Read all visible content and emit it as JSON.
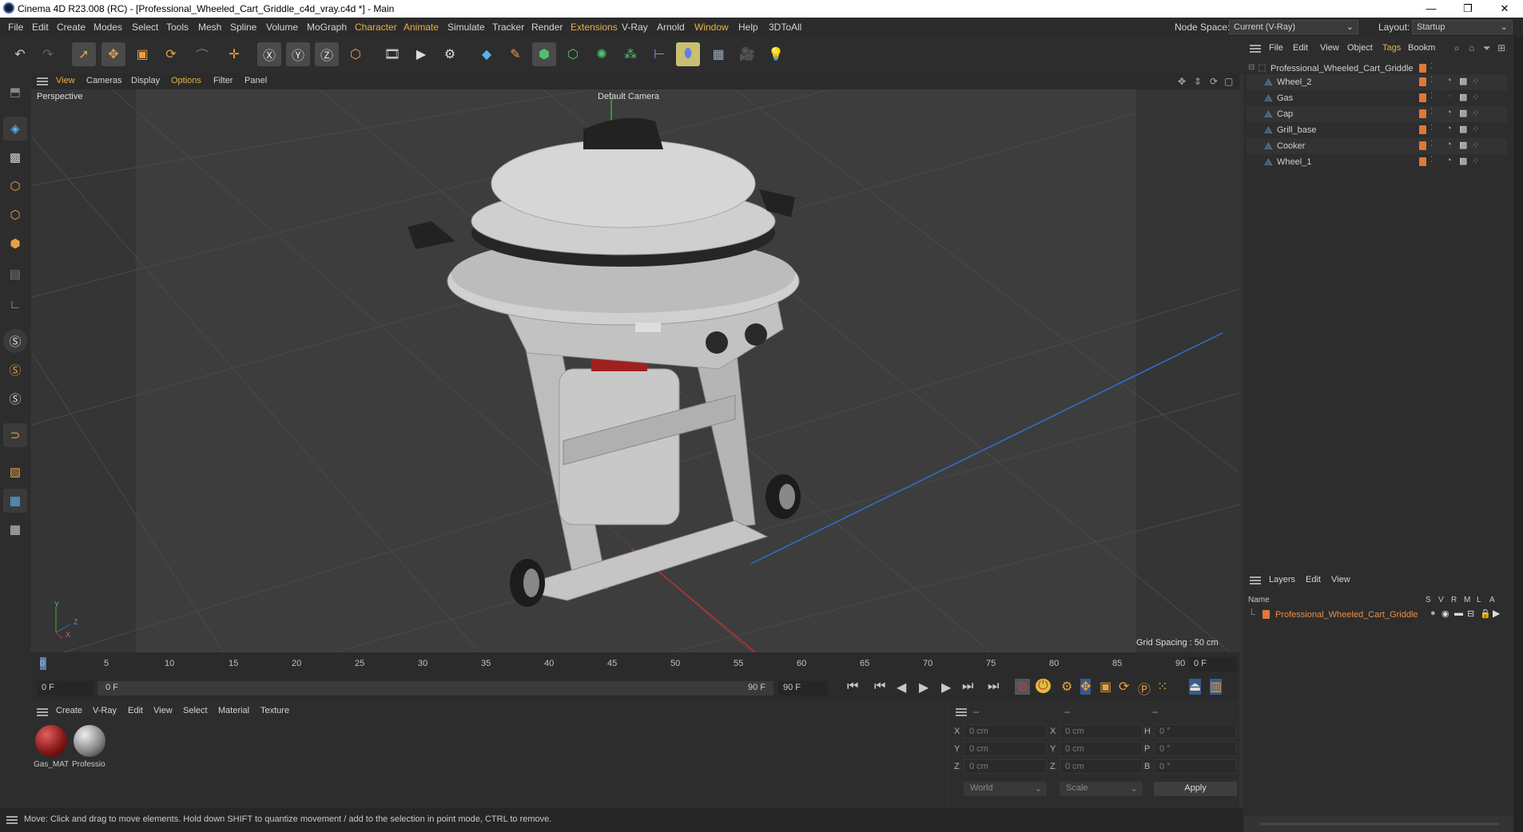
{
  "app": {
    "title": "Cinema 4D R23.008 (RC) - [Professional_Wheeled_Cart_Griddle_c4d_vray.c4d *] - Main",
    "minimize": "—",
    "restore": "❐",
    "close": "✕"
  },
  "menu": {
    "items": [
      "File",
      "Edit",
      "Create",
      "Modes",
      "Select",
      "Tools",
      "Mesh",
      "Spline",
      "Volume",
      "MoGraph",
      "Character",
      "Animate",
      "Simulate",
      "Tracker",
      "Render",
      "Extensions",
      "V-Ray",
      "Arnold",
      "Window",
      "Help",
      "3DToAll"
    ],
    "node_space_label": "Node Space:",
    "node_space_value": "Current (V-Ray)",
    "layout_label": "Layout:",
    "layout_value": "Startup"
  },
  "viewport": {
    "menu": [
      "View",
      "Cameras",
      "Display",
      "Options",
      "Filter",
      "Panel"
    ],
    "label": "Perspective",
    "camera": "Default Camera",
    "grid_spacing": "Grid Spacing : 50 cm",
    "axis_y": "Y",
    "axis_z": "Z",
    "axis_x": "X"
  },
  "timeline": {
    "ticks": [
      "0",
      "5",
      "10",
      "15",
      "20",
      "25",
      "30",
      "35",
      "40",
      "45",
      "50",
      "55",
      "60",
      "65",
      "70",
      "75",
      "80",
      "85",
      "90"
    ],
    "current_frame": "0 F",
    "start": "0 F",
    "range_start": "0 F",
    "range_end": "90 F",
    "end": "90 F"
  },
  "materials": {
    "menu": [
      "Create",
      "V-Ray",
      "Edit",
      "View",
      "Select",
      "Material",
      "Texture"
    ],
    "items": [
      {
        "label": "Gas_MAT",
        "color": "#8a1a1a"
      },
      {
        "label": "Professio",
        "color": "#9a9a9a"
      }
    ]
  },
  "coords": {
    "header": [
      "--",
      "--",
      "--"
    ],
    "rows": [
      {
        "l1": "X",
        "v1": "0 cm",
        "l2": "X",
        "v2": "0 cm",
        "l3": "H",
        "v3": "0 °"
      },
      {
        "l1": "Y",
        "v1": "0 cm",
        "l2": "Y",
        "v2": "0 cm",
        "l3": "P",
        "v3": "0 °"
      },
      {
        "l1": "Z",
        "v1": "0 cm",
        "l2": "Z",
        "v2": "0 cm",
        "l3": "B",
        "v3": "0 °"
      }
    ],
    "mode1": "World",
    "mode2": "Scale",
    "apply": "Apply"
  },
  "objects": {
    "menu": [
      "File",
      "Edit",
      "View",
      "Object",
      "Tags",
      "Bookm"
    ],
    "root": "Professional_Wheeled_Cart_Griddle",
    "items": [
      "Wheel_2",
      "Gas",
      "Cap",
      "Grill_base",
      "Cooker",
      "Wheel_1"
    ]
  },
  "layers": {
    "menu": [
      "Layers",
      "Edit",
      "View"
    ],
    "col_name": "Name",
    "cols": [
      "S",
      "V",
      "R",
      "M",
      "L",
      "A"
    ],
    "item": "Professional_Wheeled_Cart_Griddle"
  },
  "status": {
    "text": "Move: Click and drag to move elements. Hold down SHIFT to quantize movement / add to the selection in point mode, CTRL to remove."
  },
  "colors": {
    "accent": "#e07838",
    "highlight_menu": "#e8b04a",
    "axis_x": "#c03030",
    "axis_z": "#3070d0"
  }
}
